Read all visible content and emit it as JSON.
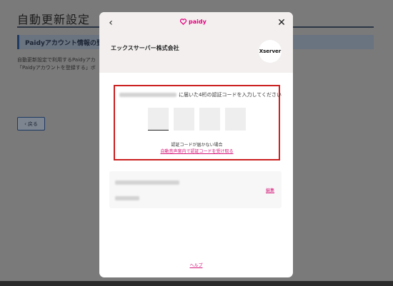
{
  "background": {
    "title": "自動更新設定",
    "section_title": "Paidyアカウント情報の登録",
    "text_line1": "自動更新設定で利用するPaidyアカ",
    "text_line2": "「Paidyアカウントを登録する」ボ",
    "back_label": "戻る"
  },
  "modal": {
    "logo_text": "paidy",
    "merchant_name": "エックスサーバー株式会社",
    "merchant_logo_text": "Xserver",
    "code_prompt": "に届いた4桁の認証コードを入力してください",
    "otp_digits": [
      "",
      "",
      "",
      ""
    ],
    "hint_text": "認証コードが届かない場合",
    "hint_link": "自動音声案内で認証コードを受け取る",
    "edit_label": "編集",
    "help_label": "ヘルプ"
  },
  "colors": {
    "accent": "#d6167a",
    "highlight_border": "#cc1f1f"
  }
}
